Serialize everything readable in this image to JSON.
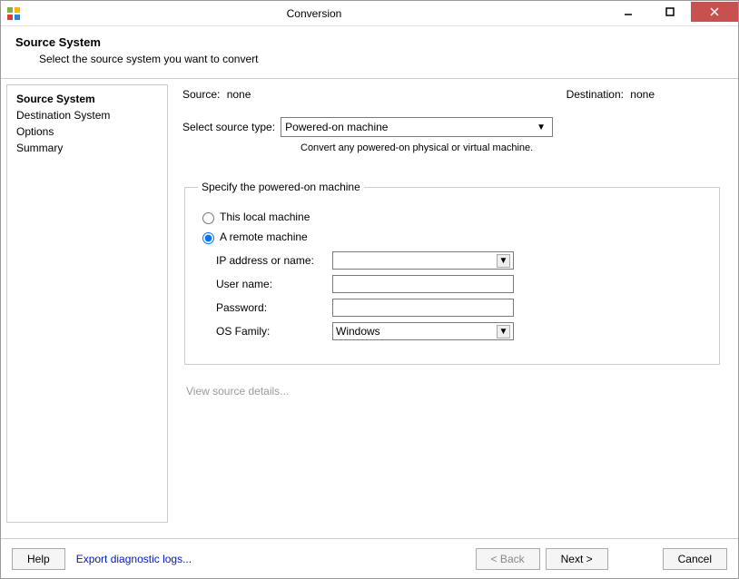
{
  "window": {
    "title": "Conversion"
  },
  "header": {
    "title": "Source System",
    "subtitle": "Select the source system you want to convert"
  },
  "sidebar": {
    "items": [
      {
        "label": "Source System",
        "active": true
      },
      {
        "label": "Destination System",
        "active": false
      },
      {
        "label": "Options",
        "active": false
      },
      {
        "label": "Summary",
        "active": false
      }
    ]
  },
  "main": {
    "source_label": "Source:",
    "source_value": "none",
    "destination_label": "Destination:",
    "destination_value": "none",
    "select_source_label": "Select source type:",
    "select_source_value": "Powered-on machine",
    "select_source_hint": "Convert any powered-on physical or virtual machine.",
    "group_legend": "Specify the powered-on machine",
    "radio_local": "This local machine",
    "radio_remote": "A remote machine",
    "field_ip_label": "IP address or name:",
    "field_ip_value": "",
    "field_user_label": "User name:",
    "field_user_value": "",
    "field_pass_label": "Password:",
    "field_pass_value": "",
    "field_os_label": "OS Family:",
    "field_os_value": "Windows",
    "view_details": "View source details..."
  },
  "footer": {
    "help": "Help",
    "export_link": "Export diagnostic logs...",
    "back": "< Back",
    "next": "Next >",
    "cancel": "Cancel"
  }
}
